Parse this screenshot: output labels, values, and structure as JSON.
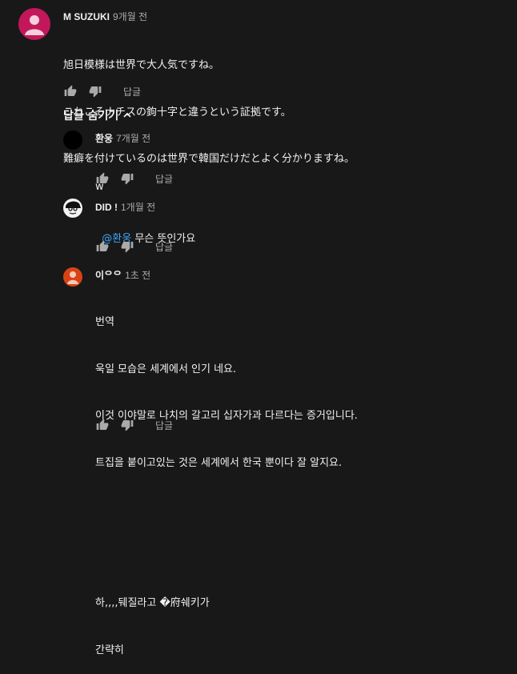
{
  "comment": {
    "author": "M SUZUKI",
    "time": "9개월 전",
    "lines": [
      "旭日模様は世界で大人気ですね。",
      "これこそナチスの鉤十字と違うという証拠です。",
      "難癖を付けているのは世界で韓国だけだとよく分かりますね。"
    ],
    "reply_label": "답글",
    "avatar_color": "#c2185b"
  },
  "replies_toggle": {
    "label": "답글 숨기기"
  },
  "replies": [
    {
      "author": "환웅",
      "time": "7개월 전",
      "lines": [
        "w"
      ],
      "reply_label": "답글"
    },
    {
      "author": "DID !",
      "time": "1개월 전",
      "mention": "@환웅",
      "text": " 무슨 뜻인가요",
      "reply_label": "답글"
    },
    {
      "author": "이ᄋᄋ",
      "time": "1초 전",
      "lines": [
        "번역",
        "욱일 모습은 세계에서 인기 네요.",
        "이것 이야말로 나치의 갈고리 십자가과 다르다는 증거입니다.",
        "트집을 붙이고있는 것은 세계에서 한국 뿐이다 잘 알지요.",
        "",
        "",
        "하,,,,뒈질라고 �府쉐키가",
        "간략히"
      ],
      "reply_label": "답글",
      "avatar_color": "#d84315"
    }
  ],
  "colors": {
    "background": "#181818",
    "text": "#f1f1f1",
    "secondary": "#aaaaaa",
    "link": "#3ea6ff"
  }
}
